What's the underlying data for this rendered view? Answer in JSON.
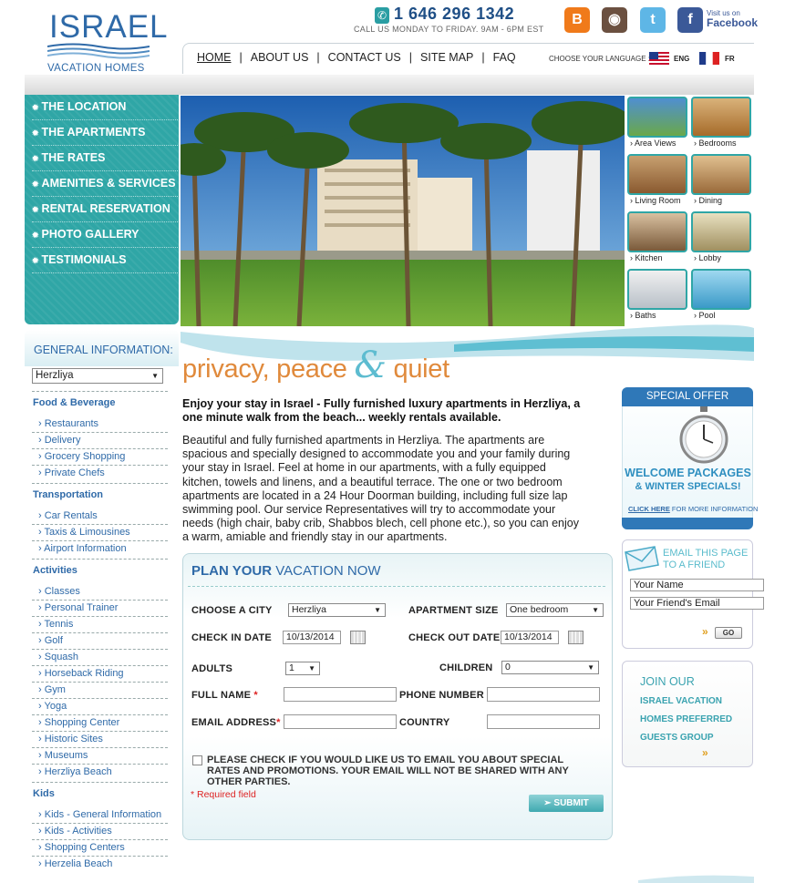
{
  "header": {
    "logo_main": "ISRAEL",
    "logo_sub": "VACATION HOMES",
    "phone": "1 646 296 1342",
    "call_hours": "CALL US MONDAY TO FRIDAY.  9AM - 6PM EST",
    "facebook_small": "Visit us on",
    "facebook_big": "Facebook"
  },
  "nav": {
    "items": [
      "HOME",
      "ABOUT US",
      "CONTACT US",
      "SITE MAP",
      "FAQ"
    ],
    "language_label": "CHOOSE YOUR LANGUAGE :",
    "languages": [
      "ENG",
      "FR"
    ]
  },
  "side_menu": {
    "items": [
      "THE LOCATION",
      "THE APARTMENTS",
      "THE RATES",
      "AMENITIES & SERVICES",
      "RENTAL RESERVATION",
      "PHOTO GALLERY",
      "TESTIMONIALS"
    ]
  },
  "thumbs": [
    "Area Views",
    "Bedrooms",
    "Living Room",
    "Dining",
    "Kitchen",
    "Lobby",
    "Baths",
    "Pool"
  ],
  "general_info": {
    "title_a": "GENERAL ",
    "title_b": "INFORMATION:",
    "city": "Herzliya",
    "categories": [
      {
        "name": "Food & Beverage",
        "links": [
          "Restaurants",
          "Delivery",
          "Grocery Shopping",
          "Private Chefs"
        ]
      },
      {
        "name": "Transportation",
        "links": [
          "Car Rentals",
          "Taxis & Limousines",
          "Airport Information"
        ]
      },
      {
        "name": "Activities",
        "links": [
          "Classes",
          "Personal Trainer",
          "Tennis",
          "Golf",
          "Squash",
          "Horseback Riding",
          "Gym",
          "Yoga",
          "Shopping Center",
          "Historic Sites",
          "Museums",
          "Herzliya Beach"
        ]
      },
      {
        "name": "Kids",
        "links": [
          "Kids - General Information",
          "Kids - Activities",
          "Shopping Centers",
          "Herzelia Beach"
        ]
      }
    ]
  },
  "main": {
    "tagline_a": "privacy, peace",
    "tagline_amp": "&",
    "tagline_b": "quiet",
    "intro": "Enjoy your stay in Israel - Fully furnished luxury apartments in Herzliya, a one minute walk from the beach... weekly rentals available.",
    "body": "Beautiful and fully furnished apartments in Herzliya. The apartments are spacious and specially designed to accommodate you and your family during your stay in Israel. Feel at home in our apartments, with a fully equipped kitchen, towels and linens, and a beautiful terrace. The one or two bedroom apartments are located in a 24 Hour Doorman building, including full size lap swimming pool. Our service Representatives will try to accommodate your needs (high chair, baby crib, Shabbos blech, cell phone etc.), so you can enjoy a warm, amiable and friendly stay in our apartments."
  },
  "form": {
    "title_a": "PLAN YOUR",
    "title_b": " VACATION NOW",
    "choose_city_label": "CHOOSE A CITY",
    "city_value": "Herzliya",
    "apt_size_label": "APARTMENT SIZE",
    "apt_size_value": "One bedroom",
    "checkin_label": "CHECK IN DATE",
    "checkin_value": "10/13/2014",
    "checkout_label": "CHECK OUT DATE",
    "checkout_value": "10/13/2014",
    "adults_label": "ADULTS",
    "adults_value": "1",
    "children_label": "CHILDREN",
    "children_value": "0",
    "fullname_label": "FULL NAME",
    "phone_label": "PHONE NUMBER",
    "email_label": "EMAIL ADDRESS",
    "country_label": "COUNTRY",
    "required_star": "*",
    "checkbox_text": "PLEASE CHECK IF YOU WOULD LIKE US TO EMAIL YOU ABOUT SPECIAL RATES AND PROMOTIONS. YOUR EMAIL WILL NOT BE SHARED WITH ANY OTHER PARTIES.",
    "required_note": "* Required field",
    "submit": "SUBMIT"
  },
  "special_offer": {
    "head": "SPECIAL OFFER",
    "welcome": "WELCOME PACKAGES",
    "winter": "& WINTER SPECIALS!",
    "click_a": "CLICK HERE",
    "click_b": " FOR MORE INFORMATION"
  },
  "email_friend": {
    "title_a": "EMAIL THIS PAGE",
    "title_b": "TO A FRIEND",
    "your_name": "Your Name",
    "friend_email": "Your Friend's Email",
    "go": "GO"
  },
  "join": {
    "title": "JOIN OUR",
    "line1": "ISRAEL VACATION",
    "line2": "HOMES PREFERRED",
    "line3": "GUESTS GROUP"
  },
  "colors": {
    "teal": "#2fa6a6",
    "blue": "#2f6aa8",
    "orange": "#e08a3c"
  }
}
